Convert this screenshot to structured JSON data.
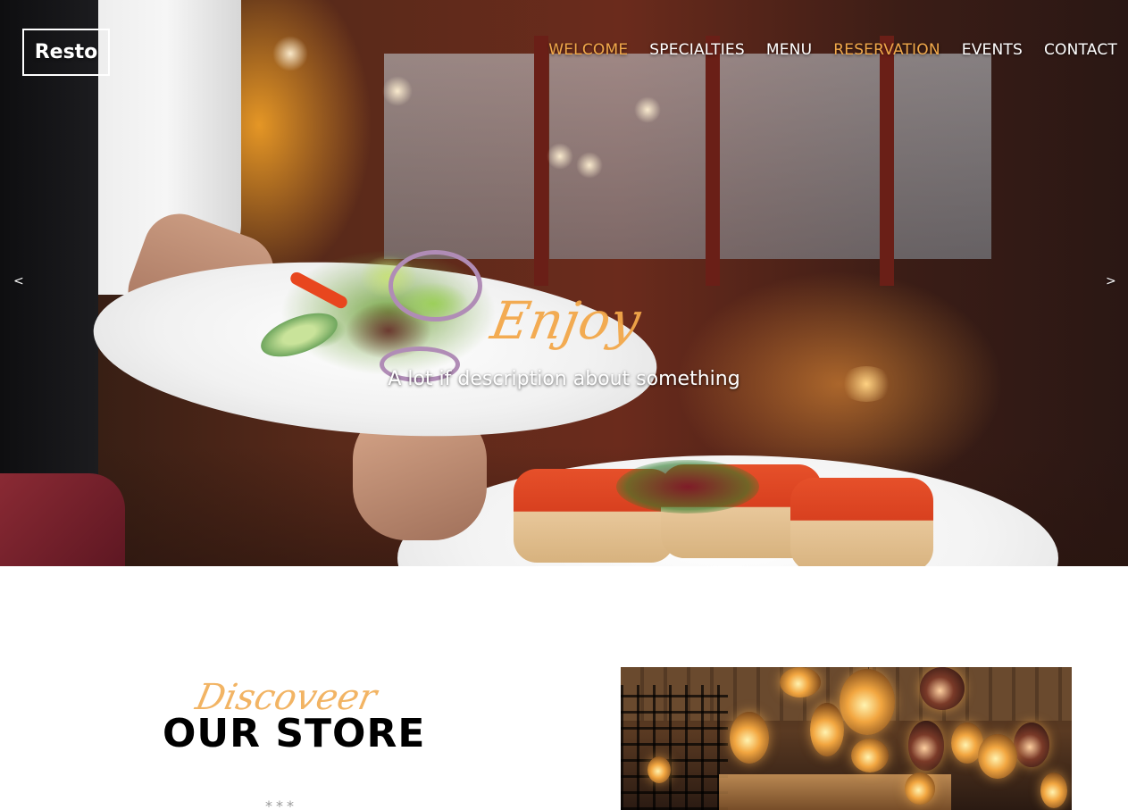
{
  "brand": {
    "logo_text": "Resto"
  },
  "nav": {
    "items": [
      {
        "label": "WELCOME",
        "active": true
      },
      {
        "label": "SPECIALTIES",
        "active": false
      },
      {
        "label": "MENU",
        "active": false
      },
      {
        "label": "RESERVATION",
        "active": true
      },
      {
        "label": "EVENTS",
        "active": false
      },
      {
        "label": "CONTACT",
        "active": false
      }
    ]
  },
  "hero": {
    "script_heading": "Enjoy",
    "tagline": "A lot if description about something",
    "prev_arrow": "<",
    "next_arrow": ">"
  },
  "about": {
    "script_heading": "Discoveer",
    "title": "OUR STORE",
    "divider": "***"
  },
  "colors": {
    "accent": "#f0a84a",
    "nav_text": "#ffffff",
    "title_text": "#000000",
    "divider": "#9a9a9a"
  }
}
